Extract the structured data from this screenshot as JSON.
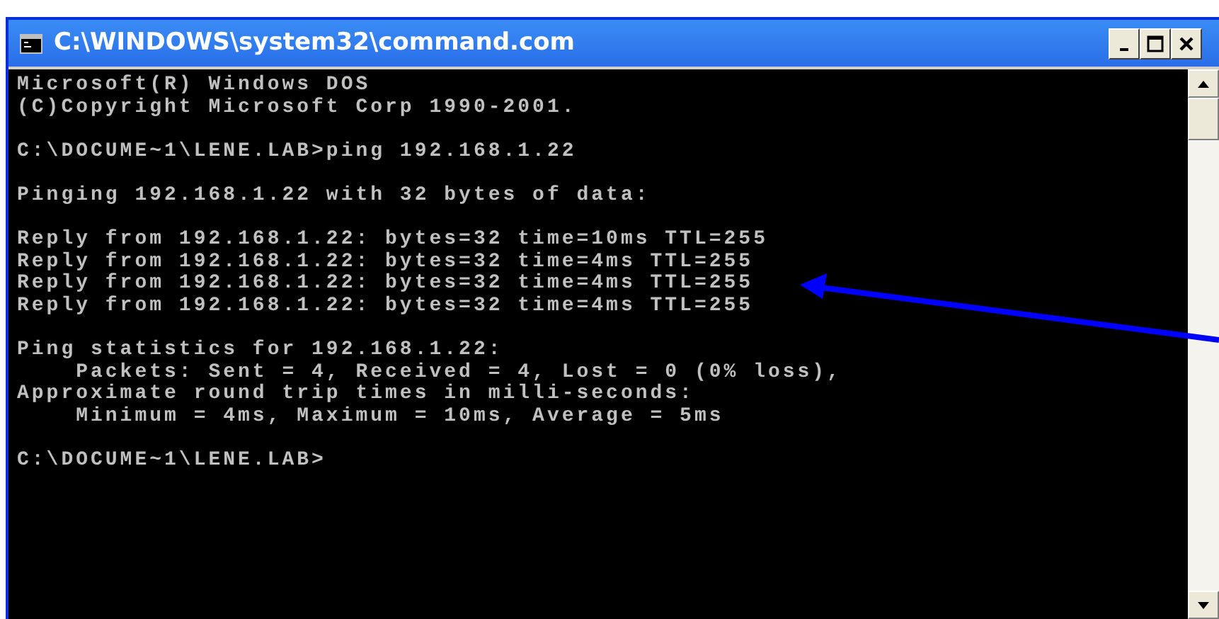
{
  "window": {
    "title": "C:\\WINDOWS\\system32\\command.com"
  },
  "console": {
    "blocks": [
      [
        "Microsoft(R) Windows DOS",
        "(C)Copyright Microsoft Corp 1990-2001."
      ],
      [
        "C:\\DOCUME~1\\LENE.LAB>ping 192.168.1.22"
      ],
      [
        "Pinging 192.168.1.22 with 32 bytes of data:"
      ],
      [
        "Reply from 192.168.1.22: bytes=32 time=10ms TTL=255",
        "Reply from 192.168.1.22: bytes=32 time=4ms TTL=255",
        "Reply from 192.168.1.22: bytes=32 time=4ms TTL=255",
        "Reply from 192.168.1.22: bytes=32 time=4ms TTL=255"
      ],
      [
        "Ping statistics for 192.168.1.22:",
        "    Packets: Sent = 4, Received = 4, Lost = 0 (0% loss),",
        "Approximate round trip times in milli-seconds:",
        "    Minimum = 4ms, Maximum = 10ms, Average = 5ms"
      ],
      [
        "C:\\DOCUME~1\\LENE.LAB>"
      ]
    ]
  }
}
